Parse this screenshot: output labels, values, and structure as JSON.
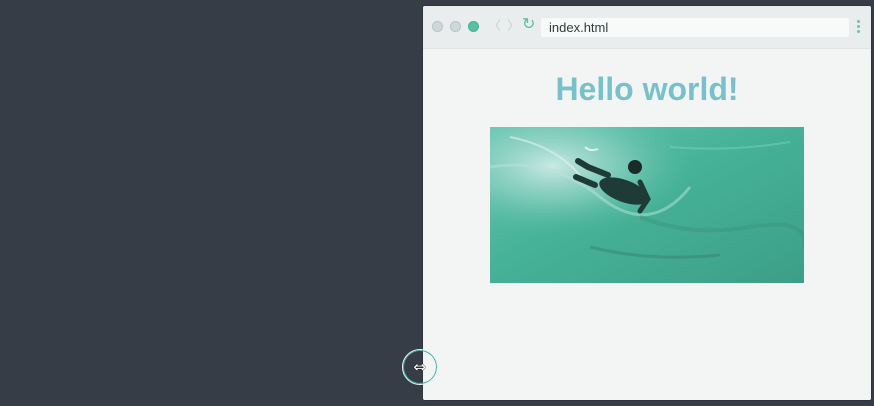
{
  "browser": {
    "address": "index.html",
    "back_glyph": "〈",
    "forward_glyph": "〉",
    "reload_glyph": "↻"
  },
  "page": {
    "heading": "Hello world!"
  },
  "colors": {
    "desktop": "#373d47",
    "heading": "#78c1cb",
    "accent": "#56c1a4"
  },
  "cursor": {
    "icon": "resize-horizontal-icon",
    "glyph": "⇔"
  }
}
